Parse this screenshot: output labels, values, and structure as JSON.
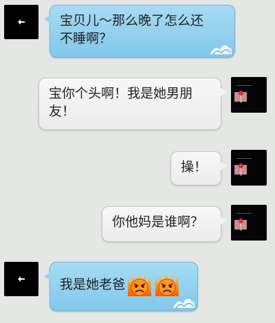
{
  "messages": [
    {
      "side": "left",
      "text": "宝贝儿～那么晚了怎么还不睡啊？",
      "line1": "宝贝儿～那么晚了怎么还",
      "line2": "不睡啊？"
    },
    {
      "side": "right",
      "text": "宝你个头啊！我是她男朋友！",
      "line1": "宝你个头啊！我是她男朋",
      "line2": "友！"
    },
    {
      "side": "right",
      "text": "操！"
    },
    {
      "side": "right",
      "text": "你他妈是谁啊？"
    },
    {
      "side": "left",
      "text": "我是她老爸",
      "emojis": [
        "angry-face-emoji",
        "angry-face-emoji"
      ]
    }
  ],
  "colors": {
    "background": "#e4e7e4",
    "left_bubble": "#9ad5f0",
    "right_bubble": "#f2f2f2",
    "avatar": "#000000"
  },
  "icons": {
    "left_avatar": "back-arrow-icon",
    "right_avatar": "profile-photo",
    "bubble_decoration": "wave-icon",
    "emoji": "angry-face-emoji"
  }
}
